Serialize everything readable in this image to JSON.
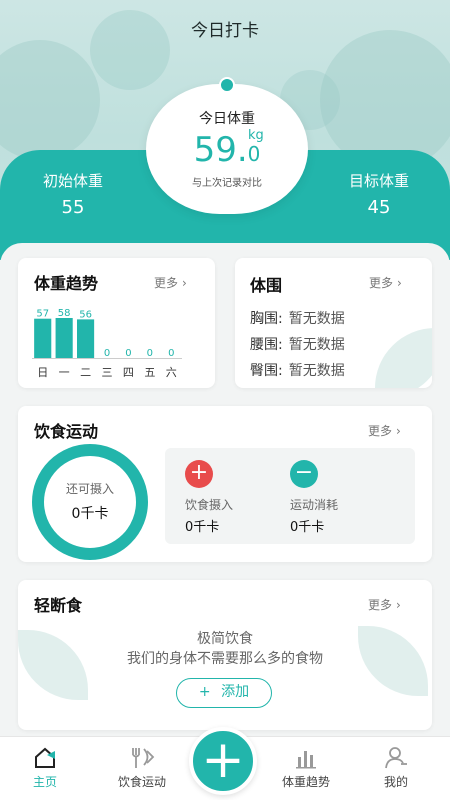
{
  "header": {
    "title": "今日打卡",
    "today_label": "今日体重",
    "weight_int": "59.",
    "weight_dec": "0",
    "unit": "kg",
    "compare_label": "与上次记录对比",
    "initial_label": "初始体重",
    "initial_value": "55",
    "target_label": "目标体重",
    "target_value": "45"
  },
  "trend_card": {
    "title": "体重趋势",
    "more": "更多",
    "chart_data": {
      "type": "bar",
      "categories": [
        "日",
        "一",
        "二",
        "三",
        "四",
        "五",
        "六"
      ],
      "values": [
        57,
        58,
        56,
        0,
        0,
        0,
        0
      ],
      "title": "",
      "xlabel": "",
      "ylabel": ""
    }
  },
  "girth_card": {
    "title": "体围",
    "more": "更多",
    "rows": [
      {
        "label": "胸围:",
        "value": "暂无数据"
      },
      {
        "label": "腰围:",
        "value": "暂无数据"
      },
      {
        "label": "臀围:",
        "value": "暂无数据"
      }
    ]
  },
  "diet_card": {
    "title": "饮食运动",
    "more": "更多",
    "ring_label": "还可摄入",
    "ring_value": "0千卡",
    "intake_label": "饮食摄入",
    "intake_value": "0千卡",
    "burn_label": "运动消耗",
    "burn_value": "0千卡",
    "plus_symbol": "+",
    "minus_symbol": "−"
  },
  "fast_card": {
    "title": "轻断食",
    "more": "更多",
    "line1": "极简饮食",
    "line2": "我们的身体不需要那么多的食物",
    "add_label": "添加",
    "add_symbol": "+"
  },
  "tabs": {
    "home": "主页",
    "diet": "饮食运动",
    "trend": "体重趋势",
    "mine": "我的",
    "center_symbol": "+"
  },
  "colors": {
    "accent": "#22b5ab",
    "danger": "#e84c4c"
  }
}
